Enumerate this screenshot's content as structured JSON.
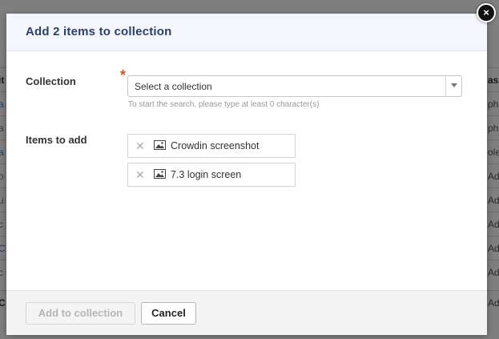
{
  "dialog": {
    "title": "Add 2 items to collection",
    "close_symbol": "×"
  },
  "form": {
    "collection_label": "Collection",
    "required_marker": "*",
    "collection_placeholder": "Select a collection",
    "collection_hint": "To start the search, please type at least 0 character(s)",
    "items_label": "Items to add",
    "items": [
      {
        "remove_symbol": "✕",
        "icon": "image-icon",
        "label": "Crowdin screenshot"
      },
      {
        "remove_symbol": "✕",
        "icon": "image-icon",
        "label": "7.3 login screen"
      }
    ]
  },
  "footer": {
    "add_label": "Add to collection",
    "cancel_label": "Cancel"
  },
  "background": {
    "left_fragments": [
      "it",
      "a",
      "a",
      "a",
      "o",
      "u",
      "c",
      "C",
      "c",
      "C"
    ],
    "right_fragments": [
      "as",
      "ph",
      "ph",
      "ole",
      "Adr",
      "Adr",
      "Adr",
      "Adr",
      "Adr",
      "Adr"
    ]
  },
  "colors": {
    "title": "#2b3f6e",
    "required": "#d9531e",
    "link": "#4a7fb5"
  }
}
